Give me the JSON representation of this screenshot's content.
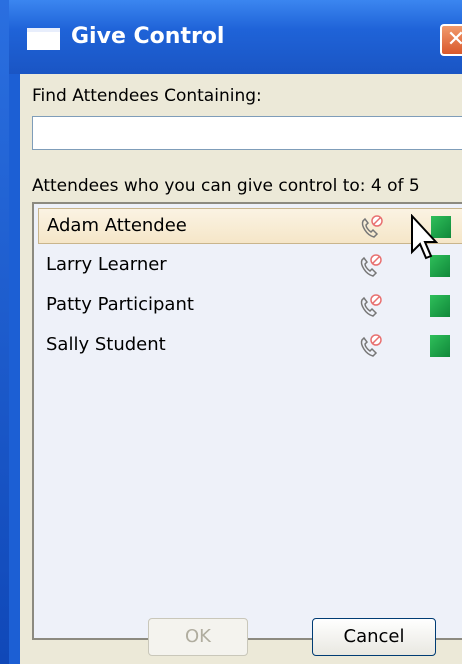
{
  "dialog": {
    "title": "Give Control",
    "close_glyph": "✕"
  },
  "search": {
    "label": "Find Attendees Containing:",
    "value": "",
    "placeholder": ""
  },
  "list": {
    "header": "Attendees who you can give control to: 4 of 5",
    "attendees": [
      {
        "name": "Adam Attendee",
        "selected": true,
        "phone_icon": "phone-muted-icon",
        "status_icon": "green-status-icon"
      },
      {
        "name": "Larry Learner",
        "selected": false,
        "phone_icon": "phone-muted-icon",
        "status_icon": "green-status-icon"
      },
      {
        "name": "Patty Participant",
        "selected": false,
        "phone_icon": "phone-muted-icon",
        "status_icon": "green-status-icon"
      },
      {
        "name": "Sally Student",
        "selected": false,
        "phone_icon": "phone-muted-icon",
        "status_icon": "green-status-icon"
      }
    ]
  },
  "buttons": {
    "ok_label": "OK",
    "ok_enabled": false,
    "cancel_label": "Cancel"
  },
  "colors": {
    "titlebar": "#1f63d8",
    "client": "#ece9d8",
    "status_green": "#1a9f48",
    "close_orange": "#d9582b"
  }
}
